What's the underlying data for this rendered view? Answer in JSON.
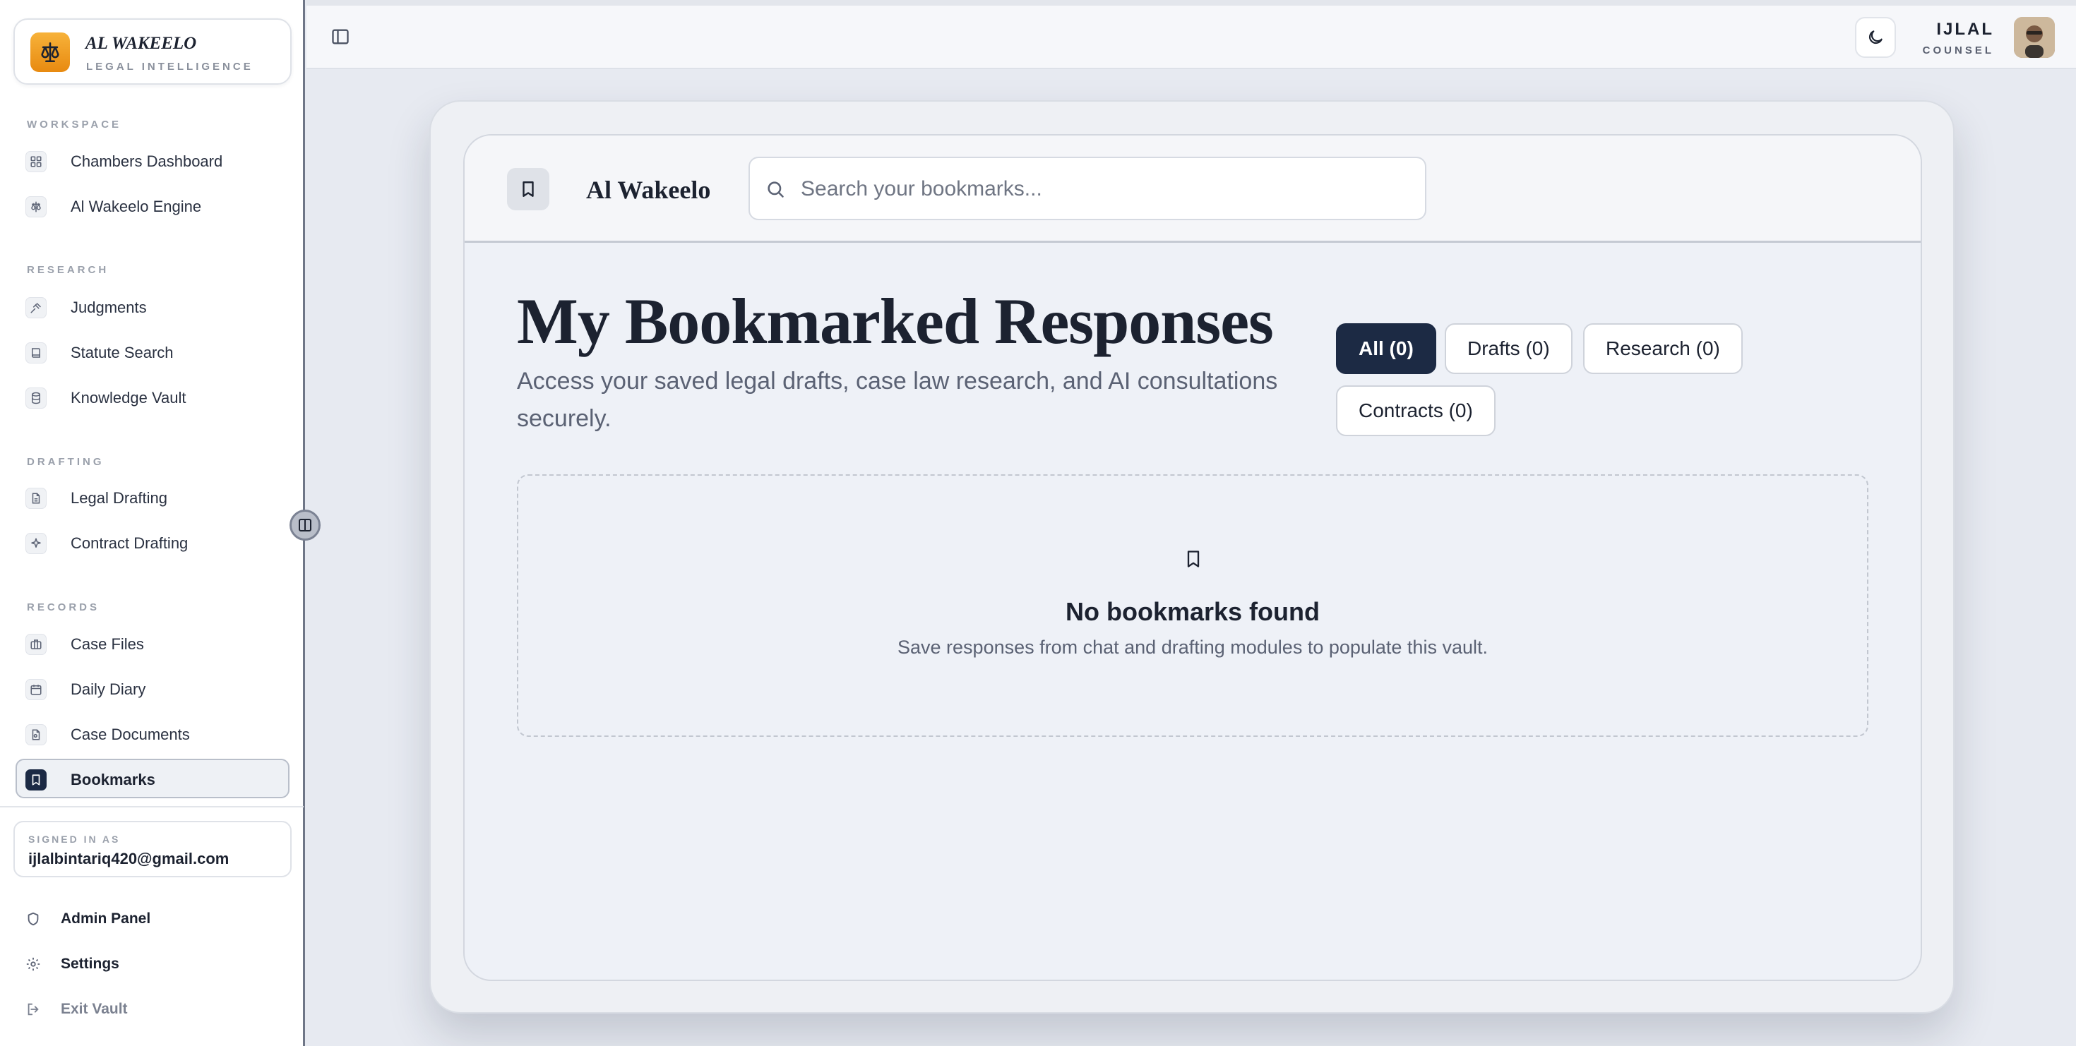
{
  "brand": {
    "name": "AL WAKEELO",
    "subtitle": "LEGAL INTELLIGENCE"
  },
  "sidebar": {
    "sections": [
      {
        "label": "WORKSPACE",
        "items": [
          {
            "label": "Chambers Dashboard",
            "icon": "grid-icon"
          },
          {
            "label": "Al Wakeelo Engine",
            "icon": "scale-icon"
          }
        ]
      },
      {
        "label": "RESEARCH",
        "items": [
          {
            "label": "Judgments",
            "icon": "gavel-icon"
          },
          {
            "label": "Statute Search",
            "icon": "book-icon"
          },
          {
            "label": "Knowledge Vault",
            "icon": "database-icon"
          }
        ]
      },
      {
        "label": "DRAFTING",
        "items": [
          {
            "label": "Legal Drafting",
            "icon": "file-text-icon"
          },
          {
            "label": "Contract Drafting",
            "icon": "sparkles-icon"
          }
        ]
      },
      {
        "label": "RECORDS",
        "items": [
          {
            "label": "Case Files",
            "icon": "briefcase-icon"
          },
          {
            "label": "Daily Diary",
            "icon": "calendar-icon"
          },
          {
            "label": "Case Documents",
            "icon": "file-search-icon"
          },
          {
            "label": "Bookmarks",
            "icon": "bookmark-icon",
            "active": true
          }
        ]
      }
    ],
    "signed_in": {
      "label": "SIGNED IN AS",
      "email": "ijlalbintariq420@gmail.com"
    },
    "footer": [
      {
        "label": "Admin Panel",
        "icon": "shield-icon"
      },
      {
        "label": "Settings",
        "icon": "gear-icon"
      },
      {
        "label": "Exit Vault",
        "icon": "logout-icon"
      }
    ]
  },
  "topbar": {
    "user_name": "IJLAL",
    "user_role": "COUNSEL"
  },
  "main": {
    "header_title": "Al Wakeelo",
    "search_placeholder": "Search your bookmarks...",
    "title": "My Bookmarked Responses",
    "description": "Access your saved legal drafts, case law research, and AI consultations securely.",
    "filters": [
      {
        "label": "All (0)",
        "active": true
      },
      {
        "label": "Drafts (0)"
      },
      {
        "label": "Research (0)"
      },
      {
        "label": "Contracts (0)"
      }
    ],
    "empty": {
      "title": "No bookmarks found",
      "subtitle": "Save responses from chat and drafting modules to populate this vault."
    }
  },
  "colors": {
    "accent": "#1c2a44",
    "brand": "#f0a02a"
  }
}
